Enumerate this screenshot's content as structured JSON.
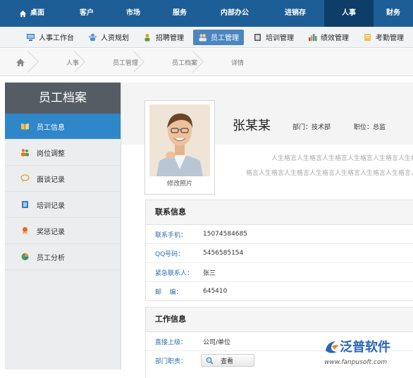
{
  "topnav": {
    "items": [
      {
        "label": "桌面",
        "w": 90
      },
      {
        "label": "客户",
        "w": 66
      },
      {
        "label": "市场",
        "w": 66
      },
      {
        "label": "服务",
        "w": 66
      },
      {
        "label": "内部办公",
        "w": 90
      },
      {
        "label": "进销存",
        "w": 82
      },
      {
        "label": "人事",
        "w": 70
      },
      {
        "label": "财务",
        "w": 56
      }
    ]
  },
  "subnav": {
    "items": [
      {
        "label": "人事工作台",
        "icon": "monitor-icon",
        "color": "#3a6fb0"
      },
      {
        "label": "人资规划",
        "icon": "people-icon",
        "color": "#4a90d0"
      },
      {
        "label": "招聘管理",
        "icon": "user-icon",
        "color": "#e0a020"
      },
      {
        "label": "员工管理",
        "icon": "users-icon",
        "color": "#ffffff"
      },
      {
        "label": "培训管理",
        "icon": "book-icon",
        "color": "#555555"
      },
      {
        "label": "绩效管理",
        "icon": "chart-icon",
        "color": "#d04030"
      },
      {
        "label": "考勤管理",
        "icon": "note-icon",
        "color": "#e0b040"
      }
    ]
  },
  "breadcrumb": [
    "人事",
    "员工管理",
    "员工档案",
    "详情"
  ],
  "sidebar": {
    "title": "员工档案",
    "items": [
      {
        "label": "员工信息",
        "icon": "book-icon",
        "color": "#f5c040"
      },
      {
        "label": "岗位调整",
        "icon": "users-icon",
        "color": "#e07820"
      },
      {
        "label": "面谈记录",
        "icon": "chat-icon",
        "color": "#e0a030"
      },
      {
        "label": "培训记录",
        "icon": "book-icon",
        "color": "#3a7cc0"
      },
      {
        "label": "奖惩记录",
        "icon": "award-icon",
        "color": "#e06a20"
      },
      {
        "label": "员工分析",
        "icon": "pie-icon",
        "color": "#4aa050"
      }
    ]
  },
  "profile": {
    "photo_label": "修改照片",
    "name": "张某某",
    "dept_label": "部门：",
    "dept": "技术部",
    "title_label": "职位：",
    "title": "总监",
    "motto_line1": "人生格言人生格言人生格言人生格言人生格言人生格",
    "motto_line2": "格言人生格言人生格言人生格言人生格言人生格言人生格言人"
  },
  "contact": {
    "heading": "联系信息",
    "rows": [
      {
        "label": "联系手机：",
        "value": "15074584685"
      },
      {
        "label": "QQ号码：",
        "value": "5456585154"
      },
      {
        "label": "紧急联系人：",
        "value": "张三"
      },
      {
        "label": "邮    编：",
        "value": "645410"
      }
    ]
  },
  "work": {
    "heading": "工作信息",
    "superior_label": "直接上级：",
    "superior": "公司/单位",
    "duty_label": "部门职责：",
    "view_button": "查看"
  },
  "watermark": {
    "brand": "泛普软件",
    "url": "www.fanpusoft.com"
  },
  "colors": {
    "topnav_bg": "#1e5e96",
    "topnav_active": "#0d3e68",
    "subnav_active": "#4c86c0",
    "sidebar_active": "#2f86c9",
    "label_blue": "#2a6fb0"
  }
}
